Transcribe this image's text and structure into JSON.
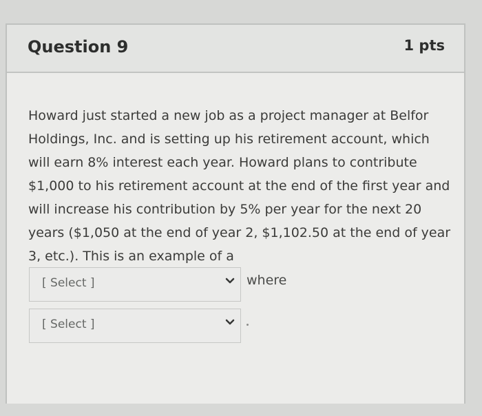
{
  "question": {
    "title": "Question 9",
    "points": "1 pts",
    "text": "Howard just started a new job as a project manager at Belfor Holdings, Inc. and is setting up his retirement account, which will earn 8% interest each year. Howard plans to contribute $1,000 to his retirement account at the end of the first year and will increase his contribution by 5% per year for the next 20 years ($1,050 at the end of year 2, $1,102.50 at the end of year 3, etc.). This is an example of a",
    "select_1": {
      "value": "[ Select ]",
      "icon": "chevron-down-icon"
    },
    "connector": "where",
    "select_2": {
      "value": "[ Select ]",
      "icon": "chevron-down-icon"
    },
    "ending": "."
  }
}
